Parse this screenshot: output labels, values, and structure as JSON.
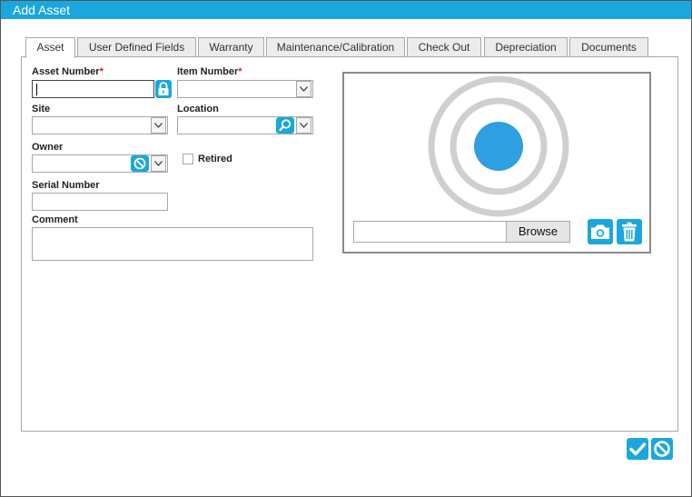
{
  "window": {
    "title": "Add Asset"
  },
  "tabs": [
    {
      "label": "Asset",
      "active": true
    },
    {
      "label": "User Defined Fields",
      "active": false
    },
    {
      "label": "Warranty",
      "active": false
    },
    {
      "label": "Maintenance/Calibration",
      "active": false
    },
    {
      "label": "Check Out",
      "active": false
    },
    {
      "label": "Depreciation",
      "active": false
    },
    {
      "label": "Documents",
      "active": false
    }
  ],
  "form": {
    "asset_number": {
      "label": "Asset Number",
      "required_mark": "*",
      "value": ""
    },
    "item_number": {
      "label": "Item Number",
      "required_mark": "*",
      "value": ""
    },
    "site": {
      "label": "Site",
      "value": ""
    },
    "location": {
      "label": "Location",
      "value": ""
    },
    "owner": {
      "label": "Owner",
      "value": ""
    },
    "retired": {
      "label": "Retired",
      "checked": false
    },
    "serial_number": {
      "label": "Serial Number",
      "value": ""
    },
    "comment": {
      "label": "Comment",
      "value": ""
    }
  },
  "picture": {
    "file_path": "",
    "browse_label": "Browse",
    "icons": [
      "camera-icon",
      "trash-icon",
      "target-placeholder-icon"
    ]
  },
  "footer": {
    "icons": [
      "checkmark-icon",
      "cancel-icon"
    ]
  },
  "colors": {
    "accent": "#1ba7dd",
    "placeholder_ring": "#cfcfcf",
    "placeholder_dot": "#2e9fe0",
    "required": "#e02020"
  }
}
